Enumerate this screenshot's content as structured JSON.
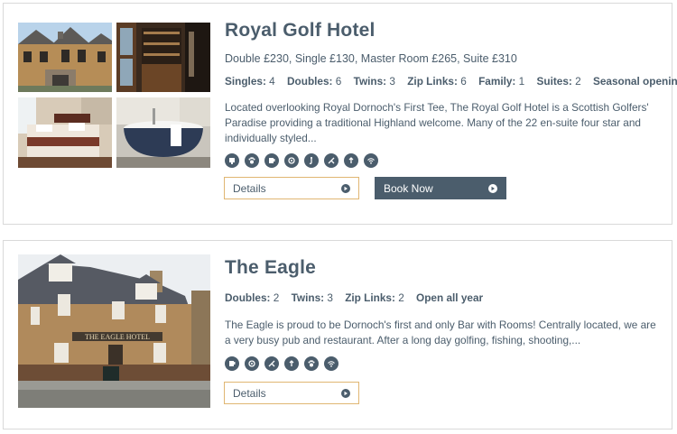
{
  "hotels": [
    {
      "name": "Royal Golf Hotel",
      "rates": "Double £230, Single £130, Master Room £265, Suite £310",
      "stats": [
        {
          "label": "Singles:",
          "value": "4"
        },
        {
          "label": "Doubles:",
          "value": "6"
        },
        {
          "label": "Twins:",
          "value": "3"
        },
        {
          "label": "Zip Links:",
          "value": "6"
        },
        {
          "label": "Family:",
          "value": "1"
        },
        {
          "label": "Suites:",
          "value": "2"
        }
      ],
      "season": "Seasonal opening",
      "description": "Located overlooking Royal Dornoch's First Tee, The Royal Golf Hotel is a Scottish Golfers' Paradise providing a traditional Highland welcome. Many of the 22 en-suite four star and individually styled...",
      "amenities": [
        "restaurant-icon",
        "pet-friendly-icon",
        "bar-icon",
        "golf-icon",
        "fishing-icon",
        "wifi-icon",
        "parking-icon",
        "wifi-signal-icon"
      ],
      "details_label": "Details",
      "book_label": "Book Now"
    },
    {
      "name": "The Eagle",
      "stats": [
        {
          "label": "Doubles:",
          "value": "2"
        },
        {
          "label": "Twins:",
          "value": "3"
        },
        {
          "label": "Zip Links:",
          "value": "2"
        }
      ],
      "season": "Open all year",
      "description": "The Eagle is proud to be Dornoch's first and only Bar with Rooms! Centrally located, we are a very busy pub and restaurant. After a long day golfing, fishing, shooting,...",
      "amenities": [
        "bar-icon",
        "golf-icon",
        "fishing-icon",
        "restaurant-icon",
        "pet-friendly-icon",
        "wifi-icon"
      ],
      "details_label": "Details"
    }
  ],
  "sign_text": "THE EAGLE HOTEL",
  "colors": {
    "primary": "#4b5d6c",
    "accent": "#e0b672"
  }
}
